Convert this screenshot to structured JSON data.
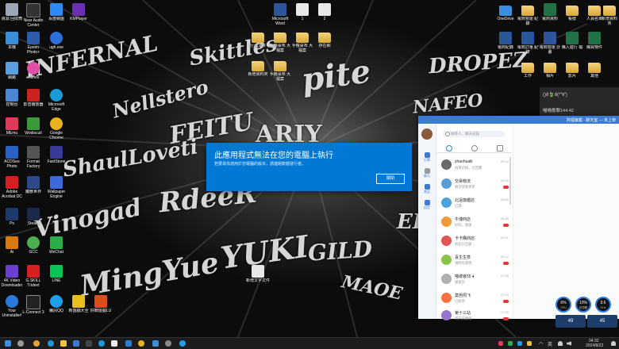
{
  "wallpaper": {
    "words": [
      "INFERNAL",
      "Skittles",
      "pite",
      "DROPEZ",
      "Nellstero",
      "NAFEO",
      "FEITU",
      "ARIY",
      "ShaulLoveti",
      "RdeeR",
      "YUKI",
      "GILD",
      "Vinogad",
      "MingYue",
      "MAOE",
      "ER"
    ]
  },
  "desktop_icons_left": [
    {
      "label": "資源\n回收筒",
      "color": "#9aa7b5"
    },
    {
      "label": "Near Audio\nCenter",
      "color": "#333333"
    },
    {
      "label": "百度網盤",
      "color": "#2f8bf1"
    },
    {
      "label": "KMPlayer",
      "color": "#6a2fb2"
    },
    {
      "label": "本機",
      "color": "#3b8fd9"
    },
    {
      "label": "Epson\nPhoto+",
      "color": "#2d5ca8"
    },
    {
      "label": "ugh.exe",
      "color": "#2d6fd8"
    },
    {
      "label": "網路",
      "color": "#5aa0e0"
    },
    {
      "label": "iTunes",
      "color": "#e14fa8"
    },
    {
      "label": "控制台",
      "color": "#4c86d4"
    },
    {
      "label": "影音播放器",
      "color": "#c22"
    },
    {
      "label": "Microsoft\nEdge",
      "color": "#1c9ad6"
    },
    {
      "label": "MEmu",
      "color": "#e03a5a"
    },
    {
      "label": "Wodiscuit",
      "color": "#3a9a3a"
    },
    {
      "label": "Google\nChrome",
      "color": "#e8b31c"
    },
    {
      "label": "ACDSee\nPhoto",
      "color": "#2a62c8"
    },
    {
      "label": "Format\nFactory",
      "color": "#555555"
    },
    {
      "label": "FastStone",
      "color": "#3a3a9a"
    },
    {
      "label": "Adobe\nAcrobat DC",
      "color": "#d32020"
    },
    {
      "label": "魔獸世界",
      "color": "#2a4a8a"
    },
    {
      "label": "Wallpaper\nEngine",
      "color": "#3b6bd9"
    },
    {
      "label": "Ps",
      "color": "#1b3b6a"
    },
    {
      "label": "Steam",
      "color": "#1a2a4a"
    },
    {
      "label": "Ai",
      "color": "#d97a10"
    },
    {
      "label": "GCC",
      "color": "#4caf50"
    },
    {
      "label": "WeChat",
      "color": "#2bae48"
    },
    {
      "label": "4K Video\nDownloader",
      "color": "#6b3fd0"
    },
    {
      "label": "G.SKILL\nTrident",
      "color": "#d82020"
    },
    {
      "label": "LINE",
      "color": "#06c755"
    },
    {
      "label": "Your\nUninstaller!",
      "color": "#2a7ad9"
    },
    {
      "label": "L-Connect 3",
      "color": "#222222"
    },
    {
      "label": "騰訊QQ",
      "color": "#1e9fe8"
    },
    {
      "label": "新遊戲大全",
      "color": "#e8c01c"
    },
    {
      "label": "好轉遊戲LU",
      "color": "#d84f1c"
    }
  ],
  "desktop_icons_center": [
    {
      "label": "Microsoft\nWord",
      "kind": "word"
    },
    {
      "label": "1",
      "kind": "doc"
    },
    {
      "label": "2",
      "kind": "doc"
    },
    {
      "label": "行政文件",
      "kind": "folder"
    },
    {
      "label": "手機桌布\n大檔案",
      "kind": "folder"
    },
    {
      "label": "手機桌布\n大檔案",
      "kind": "folder"
    },
    {
      "label": "存在網",
      "kind": "folder"
    },
    {
      "label": "新增資料夾",
      "kind": "folder"
    },
    {
      "label": "手機桌布\n大檔案",
      "kind": "folder"
    },
    {
      "label": "新增文字文件",
      "kind": "doc"
    }
  ],
  "desktop_icons_right": [
    {
      "label": "OneDrive",
      "kind": "folder"
    },
    {
      "label": "電商營運\n紀錄",
      "kind": "folder"
    },
    {
      "label": "電商資料",
      "kind": "excel"
    },
    {
      "label": "帳號",
      "kind": "folder"
    },
    {
      "label": "人員名單",
      "kind": "folder"
    },
    {
      "label": "新增資料夾",
      "kind": "folder"
    },
    {
      "label": "電商紀錄",
      "kind": "word"
    },
    {
      "label": "電商訂單\n紀錄",
      "kind": "word"
    },
    {
      "label": "電商營運\n計畫",
      "kind": "word"
    },
    {
      "label": "購入進行\n檔",
      "kind": "excel"
    },
    {
      "label": "購買物件",
      "kind": "excel"
    },
    {
      "label": "工作",
      "kind": "folder"
    },
    {
      "label": "相片",
      "kind": "folder"
    },
    {
      "label": "影片",
      "kind": "folder"
    },
    {
      "label": "其他",
      "kind": "folder"
    }
  ],
  "dialog": {
    "title": "此應用程式無法在您的電腦上執行",
    "message": "若要尋找適用於您電腦的版本，請連絡軟體發行者。",
    "close_label": "關閉"
  },
  "chat_window": {
    "title": "阿福旗艦 - 聊天室 — 未上架",
    "search_placeholder": "搜尋人、聊天記錄",
    "rail": [
      {
        "label": "訂單"
      },
      {
        "label": "聊天"
      },
      {
        "label": "商品"
      },
      {
        "label": "設定"
      }
    ],
    "conversations": [
      {
        "name": "zhanhuaili",
        "preview": "找尋待辦，已回覆",
        "time": "09:12",
        "color": "#6a6a6a",
        "badge": false
      },
      {
        "name": "交易物流",
        "preview": "物流狀態更新",
        "time": "09:08",
        "color": "#5b9bd5",
        "badge": true
      },
      {
        "name": "北遠旗艦店",
        "preview": "已讀",
        "time": "08:55",
        "color": "#4aa3df",
        "badge": false
      },
      {
        "name": "牛博商店",
        "preview": "好的，感謝",
        "time": "08:40",
        "color": "#f29b38",
        "badge": true
      },
      {
        "name": "卡卡購商店",
        "preview": "商品已出貨",
        "time": "08:31",
        "color": "#e25555",
        "badge": false
      },
      {
        "name": "喜生生草",
        "preview": "請問有貨嗎",
        "time": "08:12",
        "color": "#8bc34a",
        "badge": true
      },
      {
        "name": "喵總會55 ♦",
        "preview": "謝謝您",
        "time": "07:58",
        "color": "#b0b0b0",
        "badge": false
      },
      {
        "name": "莫芭周飞",
        "preview": "已收到",
        "time": "07:44",
        "color": "#ff7043",
        "badge": true
      },
      {
        "name": "第十三站",
        "preview": "明天再聯絡",
        "time": "07:30",
        "color": "#9575cd",
        "badge": true
      }
    ]
  },
  "notification": {
    "line1": "()ð🍃ð(*'∀')",
    "line2": "喵喵歌聊144:42"
  },
  "gauges": [
    {
      "value": "6%",
      "caption": "CPU"
    },
    {
      "value": "10%",
      "caption": "記憶體"
    },
    {
      "value": "9.6",
      "caption": "GHz"
    }
  ],
  "widgets": [
    {
      "value": "49"
    },
    {
      "value": "45"
    }
  ],
  "taskbar": {
    "language": "英",
    "time": "04:32",
    "date": "2024/8/22",
    "icons": [
      {
        "name": "start-icon",
        "color": "#3b8fe0"
      },
      {
        "name": "search-icon",
        "color": "#9a9a9a"
      },
      {
        "name": "chat-app-icon",
        "color": "#e7a13a"
      },
      {
        "name": "edge-icon",
        "color": "#1c9ad6"
      },
      {
        "name": "file-explorer-icon",
        "color": "#f4c040"
      },
      {
        "name": "store-icon",
        "color": "#3a7bd5"
      },
      {
        "name": "terminal-icon",
        "color": "#444444"
      },
      {
        "name": "tiktok-icon",
        "color": "#eeeeee"
      },
      {
        "name": "mail-icon",
        "color": "#2a7ad9"
      },
      {
        "name": "chrome-icon",
        "color": "#e8b31c"
      },
      {
        "name": "photos-icon",
        "color": "#3b8fd9"
      },
      {
        "name": "settings-icon",
        "color": "#8a8a8a"
      },
      {
        "name": "qq-icon",
        "color": "#1e9fe8"
      }
    ]
  }
}
